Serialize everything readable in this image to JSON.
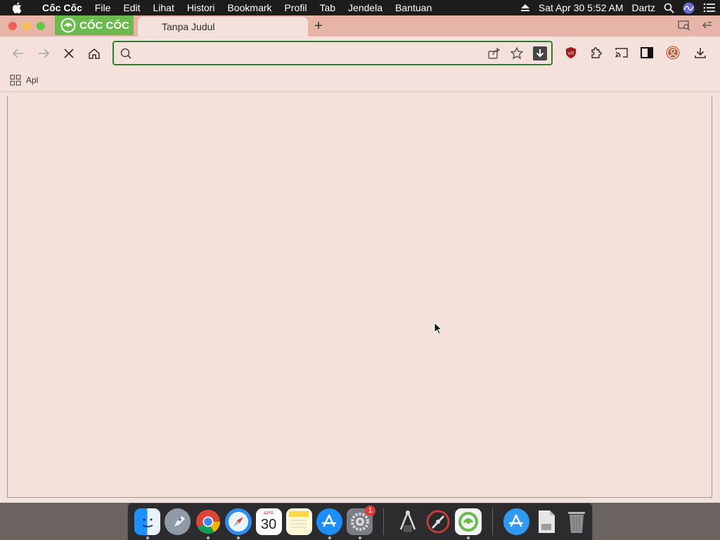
{
  "menubar": {
    "items": [
      "Cốc Cốc",
      "File",
      "Edit",
      "Lihat",
      "Histori",
      "Bookmark",
      "Profil",
      "Tab",
      "Jendela",
      "Bantuan"
    ],
    "datetime": "Sat Apr 30  5:52 AM",
    "user": "Dartz"
  },
  "tabs": {
    "brand_label": "CỐC CỐC",
    "active_title": "Tanpa Judul",
    "new_tab_symbol": "+"
  },
  "toolbar": {
    "reload_state": "stop",
    "address_value": "",
    "address_placeholder": ""
  },
  "bookmarks": {
    "apps_label": "Apl"
  },
  "dock": {
    "apps": [
      "Finder",
      "Launchpad",
      "Chrome",
      "Safari",
      "Calendar",
      "Notes",
      "App Store",
      "System Preferences",
      "Grapher",
      "Instruments",
      "Cốc Cốc",
      "App Store Utility",
      "Document",
      "Trash"
    ],
    "calendar_month": "APR",
    "calendar_day": "30",
    "system_prefs_badge": "1"
  },
  "colors": {
    "tabstrip": "#e7b5a8",
    "toolbar": "#f4e1db",
    "omnibox_border": "#2e7d32",
    "brand_green": "#6aba4e"
  }
}
